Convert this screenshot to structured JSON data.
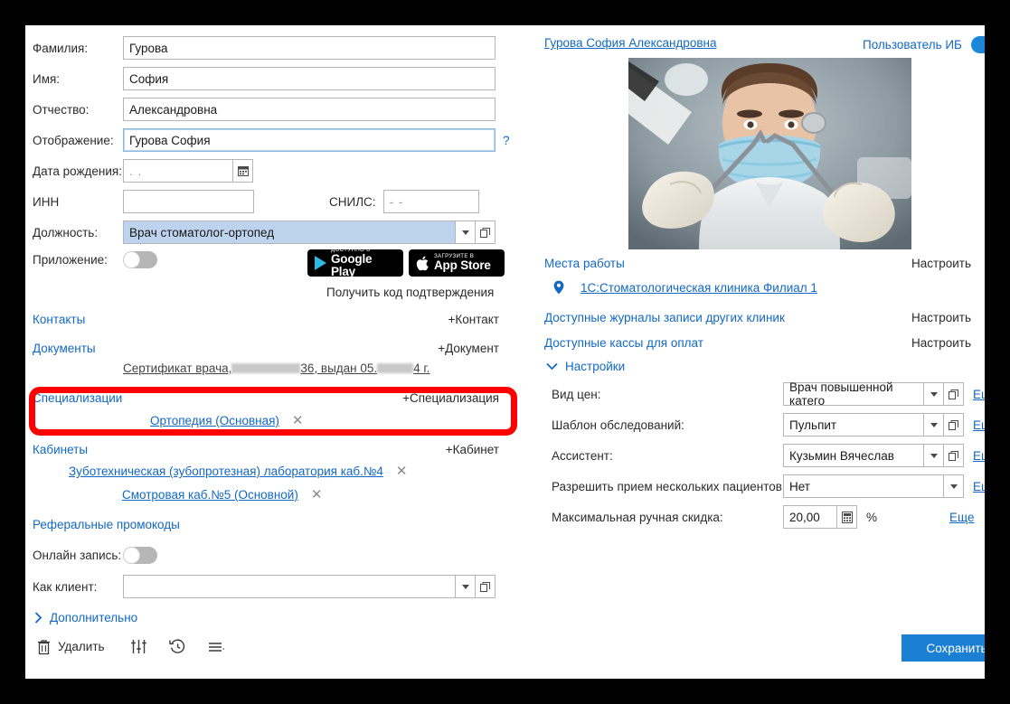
{
  "left": {
    "fields": [
      {
        "label": "Фамилия:",
        "value": "Гурова"
      },
      {
        "label": "Имя:",
        "value": "София"
      },
      {
        "label": "Отчество:",
        "value": "Александровна"
      },
      {
        "label": "Отображение:",
        "value": "Гурова София",
        "hint": "?"
      },
      {
        "label": "Дата рождения:",
        "value": "  .  ."
      },
      {
        "label": "ИНН",
        "value": ""
      },
      {
        "label": "СНИЛС:",
        "value": "  -   -"
      },
      {
        "label": "Должность:",
        "value": "Врач стоматолог-ортопед"
      },
      {
        "label": "Приложение:",
        "value": ""
      }
    ],
    "store": {
      "google_small": "ДОСТУПНО В",
      "google_big": "Google Play",
      "apple_small": "Загрузите в",
      "apple_big": "App Store",
      "get_code": "Получить код подтверждения"
    },
    "sections": [
      {
        "title": "Контакты",
        "action": "+Контакт",
        "items": []
      },
      {
        "title": "Документы",
        "action": "+Документ",
        "items": [
          {
            "text_a": "Сертификат врача, ",
            "text_b": "36, выдан 05.",
            "text_c": "4 г."
          }
        ]
      },
      {
        "title": "Специализации",
        "action": "+Специализация",
        "items": [
          {
            "text": "Ортопедия (Основная)"
          }
        ]
      },
      {
        "title": "Кабинеты",
        "action": "+Кабинет",
        "items": [
          {
            "text": "Зуботехническая (зубопротезная) лаборатория каб.№4"
          },
          {
            "text": "Смотровая каб.№5 (Основной)"
          }
        ]
      },
      {
        "title": "Реферальные промокоды",
        "action": "",
        "items": []
      }
    ],
    "online_label": "Онлайн запись:",
    "client_label": "Как клиент:",
    "client_value": "",
    "more_link": "Дополнительно",
    "toolbar": {
      "delete": "Удалить"
    }
  },
  "right": {
    "person_link": "Гурова София Александровна",
    "user_toggle_label": "Пользователь ИБ",
    "links": [
      {
        "title": "Места работы",
        "action": "Настроить"
      },
      {
        "title": "Доступные журналы записи других клиник",
        "action": "Настроить"
      },
      {
        "title": "Доступные кассы для оплат",
        "action": "Настроить"
      }
    ],
    "workplace": "1С:Стоматологическая клиника Филиал 1",
    "settings_title": "Настройки",
    "settings": [
      {
        "label": "Вид цен:",
        "value": "Врач повышенной катего",
        "more": "Еще",
        "type": "combo"
      },
      {
        "label": "Шаблон обследований:",
        "value": "Пульпит",
        "more": "Еще",
        "type": "combo"
      },
      {
        "label": "Ассистент:",
        "value": "Кузьмин Вячеслав",
        "more": "Еще",
        "type": "combo"
      },
      {
        "label": "Разрешить прием нескольких пациентов:",
        "value": "Нет",
        "more": "Еще",
        "type": "select"
      },
      {
        "label": "Максимальная ручная скидка:",
        "value": "20,00",
        "suffix": "%",
        "more": "Еще",
        "type": "number"
      }
    ],
    "save_label": "Сохранить"
  },
  "colors": {
    "accent": "#1268c3",
    "save": "#1b7fd4",
    "highlight": "#ff0000",
    "toggle_on": "#1b87da"
  }
}
